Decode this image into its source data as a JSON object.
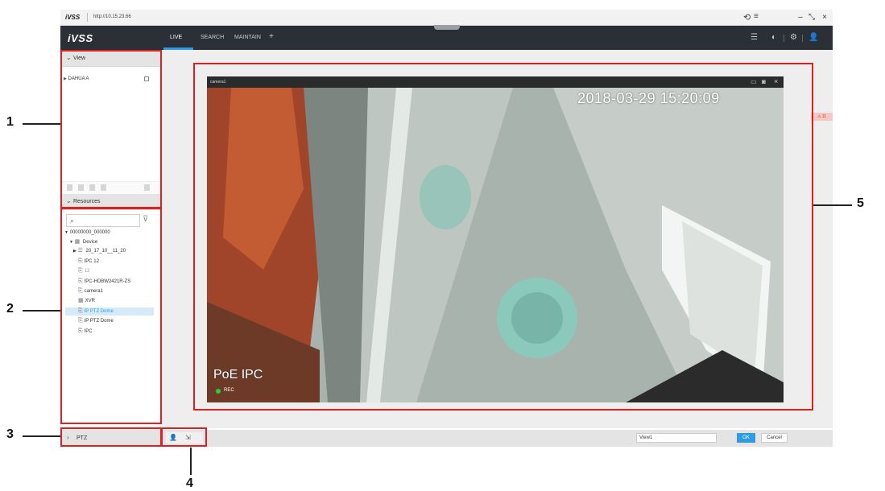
{
  "browser": {
    "brand": "iVSS",
    "url": "http://10.15.23.66",
    "refresh_icon": "refresh-icon",
    "menu_icon": "menu-icon",
    "window_controls": {
      "minimize": "–",
      "restore": "⤡",
      "close": "×"
    }
  },
  "app": {
    "logo": "iVSS",
    "tabs": [
      {
        "label": "LIVE",
        "active": true
      },
      {
        "label": "SEARCH",
        "active": false
      },
      {
        "label": "MAINTAIN",
        "active": false
      }
    ],
    "add_tab": "+",
    "accent_color": "#2f9be0",
    "header_icons": [
      "list-icon",
      "display-icon",
      "settings-icon",
      "user-icon"
    ]
  },
  "left_panel": {
    "view_section": {
      "title": "View",
      "items": [
        {
          "label": "DAHUA A"
        }
      ]
    },
    "resources_section": {
      "title": "Resources",
      "search_placeholder": "",
      "tree": [
        {
          "label": "00000000_000000",
          "level": 0
        },
        {
          "label": "Device",
          "level": 1
        },
        {
          "label": "20_17_10__11_20",
          "level": 2
        },
        {
          "label": "IPC 12",
          "level": 2
        },
        {
          "label": "12",
          "level": 2
        },
        {
          "label": "IPC-HDBW2421R-ZS",
          "level": 2
        },
        {
          "label": "camera1",
          "level": 2
        },
        {
          "label": "XVR",
          "level": 2
        },
        {
          "label": "IP PTZ Dome",
          "level": 2,
          "selected": true
        },
        {
          "label": "IP PTZ Dome",
          "level": 2
        },
        {
          "label": "IPC",
          "level": 2
        }
      ]
    },
    "ptz_section": {
      "title": "PTZ"
    }
  },
  "video": {
    "camera_title": "camera1",
    "timestamp": "2018-03-29 15:20:09",
    "osd_label": "PoE IPC",
    "rec_label": "REC",
    "alarm_badge": "⚠ 11"
  },
  "bottom_bar": {
    "view_name_value": "View1",
    "ok_label": "OK",
    "cancel_label": "Cancel"
  },
  "annotations": {
    "labels": [
      "1",
      "2",
      "3",
      "4",
      "5"
    ],
    "color": "#e02020"
  }
}
